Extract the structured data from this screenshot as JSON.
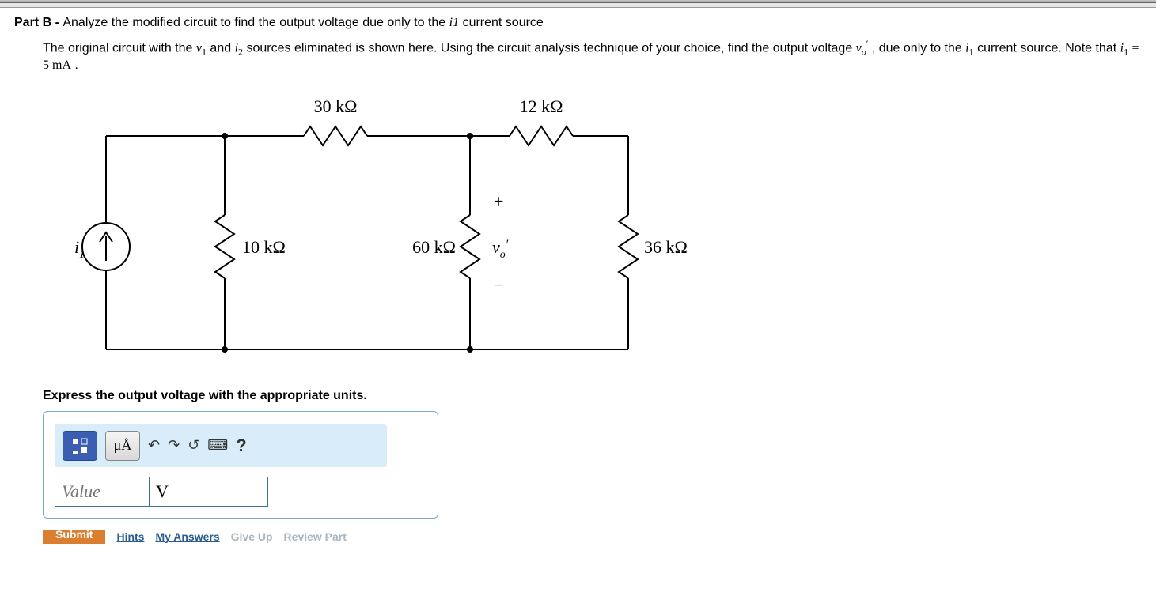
{
  "partHeader": {
    "partLabel": "Part B - ",
    "partTitle": "Analyze the modified circuit to find the output voltage due only to the ",
    "partTitleVar": "i1",
    "partTitleTail": " current source"
  },
  "question": {
    "p1": "The original circuit with the ",
    "v1": "v",
    "v1sub": "1",
    "and": " and ",
    "i2": "i",
    "i2sub": "2",
    "p2": " sources eliminated is shown here. Using the circuit analysis technique of your choice, find the output voltage ",
    "vo": "v",
    "voSub": "o",
    "voSup": "′",
    "p3": " , due only to the ",
    "i1": "i",
    "i1sub": "1",
    "p4": " current source. Note that ",
    "i1b": "i",
    "i1bsub": "1",
    "eq": " = 5 mA",
    "dot": "."
  },
  "circuit": {
    "r30": "30 kΩ",
    "r12": "12 kΩ",
    "r10": "10 kΩ",
    "r60": "60 kΩ",
    "r36": "36 kΩ",
    "i1": "i",
    "i1sub": "1",
    "vo": "v",
    "voSub": "o",
    "voSup": "′",
    "plus": "+",
    "minus": "−"
  },
  "prompt": "Express the output voltage with the appropriate units.",
  "toolbar": {
    "specialChars": "μÅ",
    "undo": "↶",
    "redo": "↷",
    "reset": "↺",
    "keyboard": "⌨",
    "help": "?"
  },
  "inputs": {
    "valuePlaceholder": "Value",
    "unitsValue": "V"
  },
  "footer": {
    "submit": "Submit",
    "hints": "Hints",
    "myAnswers": "My Answers",
    "giveUp": "Give Up",
    "reviewPart": "Review Part"
  }
}
